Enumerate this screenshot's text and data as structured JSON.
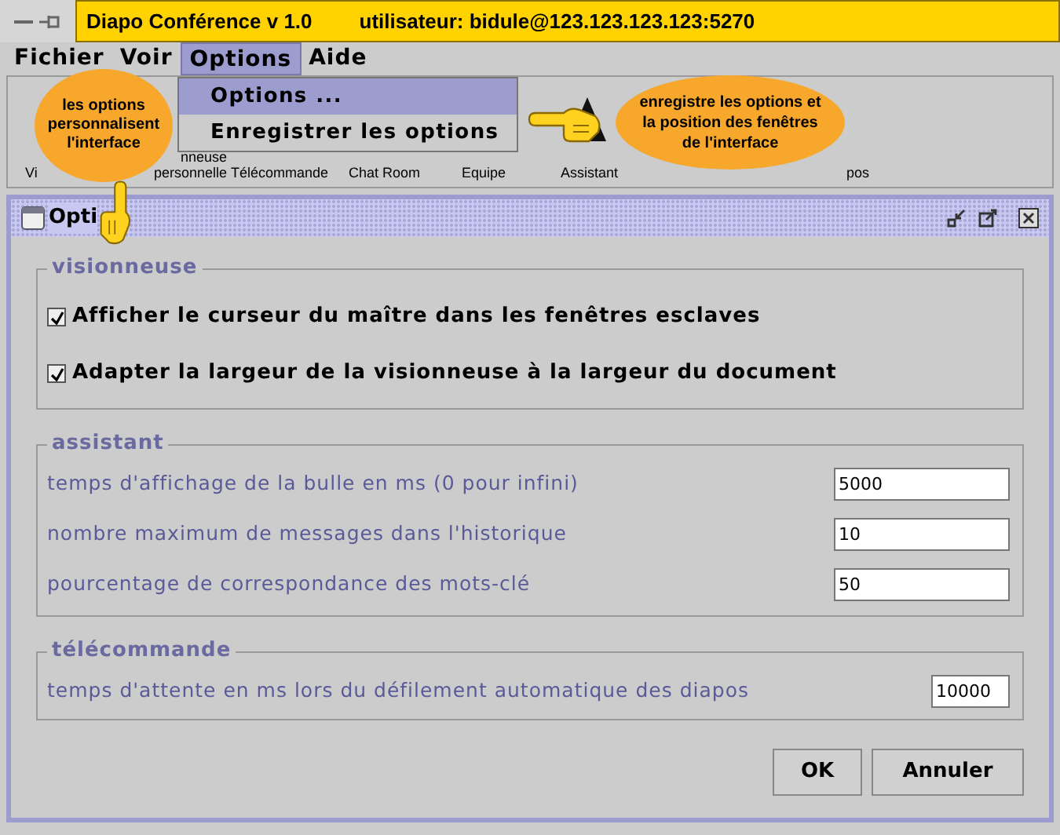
{
  "window": {
    "title": "Diapo Conférence v 1.0",
    "user": "utilisateur: bidule@123.123.123.123:5270"
  },
  "menu": [
    {
      "label": "Fichier",
      "selected": false
    },
    {
      "label": "Voir",
      "selected": false
    },
    {
      "label": "Options",
      "selected": true
    },
    {
      "label": "Aide",
      "selected": false
    }
  ],
  "dropdown": [
    {
      "label": "Options ...",
      "selected": true
    },
    {
      "label": "Enregistrer les options",
      "selected": false
    }
  ],
  "toolbar": [
    {
      "label": "Vi"
    },
    {
      "label": "personnelle",
      "top": "nneuse"
    },
    {
      "label": "Télécommande"
    },
    {
      "label": "Chat Room"
    },
    {
      "label": "Equipe"
    },
    {
      "label": "Assistant"
    },
    {
      "label": "pos"
    }
  ],
  "callouts": [
    {
      "text": "les options personnalisent l'interface"
    },
    {
      "text": "enregistre les options et la position des fenêtres de l'interface"
    }
  ],
  "dialog": {
    "title": "Opti",
    "visionneuse": {
      "title": "visionneuse",
      "options": [
        {
          "label": "Afficher le curseur du maître dans les fenêtres esclaves",
          "checked": true
        },
        {
          "label": "Adapter la largeur de la visionneuse à la largeur du document",
          "checked": true
        }
      ]
    },
    "assistant": {
      "title": "assistant",
      "fields": [
        {
          "label": "temps d'affichage de la bulle en ms (0 pour infini)",
          "value": "5000"
        },
        {
          "label": "nombre maximum de messages dans l'historique",
          "value": "10"
        },
        {
          "label": "pourcentage de correspondance des mots-clé",
          "value": "50"
        }
      ]
    },
    "telecommande": {
      "title": "télécommande",
      "fields": [
        {
          "label": "temps d'attente en ms lors du défilement automatique des diapos",
          "value": "10000"
        }
      ]
    },
    "buttons": [
      "OK",
      "Annuler"
    ]
  }
}
